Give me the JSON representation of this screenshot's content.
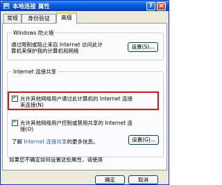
{
  "window": {
    "title": "本地连接 属性",
    "help_glyph": "?",
    "close_glyph": "×"
  },
  "tabs": [
    {
      "label": "常规"
    },
    {
      "label": "身份验证"
    },
    {
      "label": "高级"
    }
  ],
  "firewall": {
    "title": "Windows 防火墙",
    "desc_line1": "通过限制或阻止来自 Internet 访问此计",
    "desc_line2": "算机来保护我的计算机和网络",
    "settings_button": "设置(S)..."
  },
  "ics": {
    "title": "Internet 连接共享",
    "allow_connect_line1": "允许其他网络用户通过此计算机的 Internet 连接",
    "allow_connect_line2": "来连接(N)",
    "allow_connect_checked": true,
    "allow_control_line1": "允许其他网络用户控制或禁用共享的 Internet 连",
    "allow_control_line2": "接(O)",
    "allow_control_checked": true,
    "learn_prefix": "了解",
    "learn_link": "Internet 连接共享",
    "learn_suffix": "的更多信息。",
    "settings_button": "设置(G)..."
  },
  "bottom_text": "如果您不确定如何设置这些属性，请使用",
  "footer": {
    "ok_label": "确定",
    "cancel_label": "取消"
  },
  "colors": {
    "title_bar": "#0a5fe0",
    "highlight_border": "#e01010",
    "link": "#2a5db0"
  }
}
